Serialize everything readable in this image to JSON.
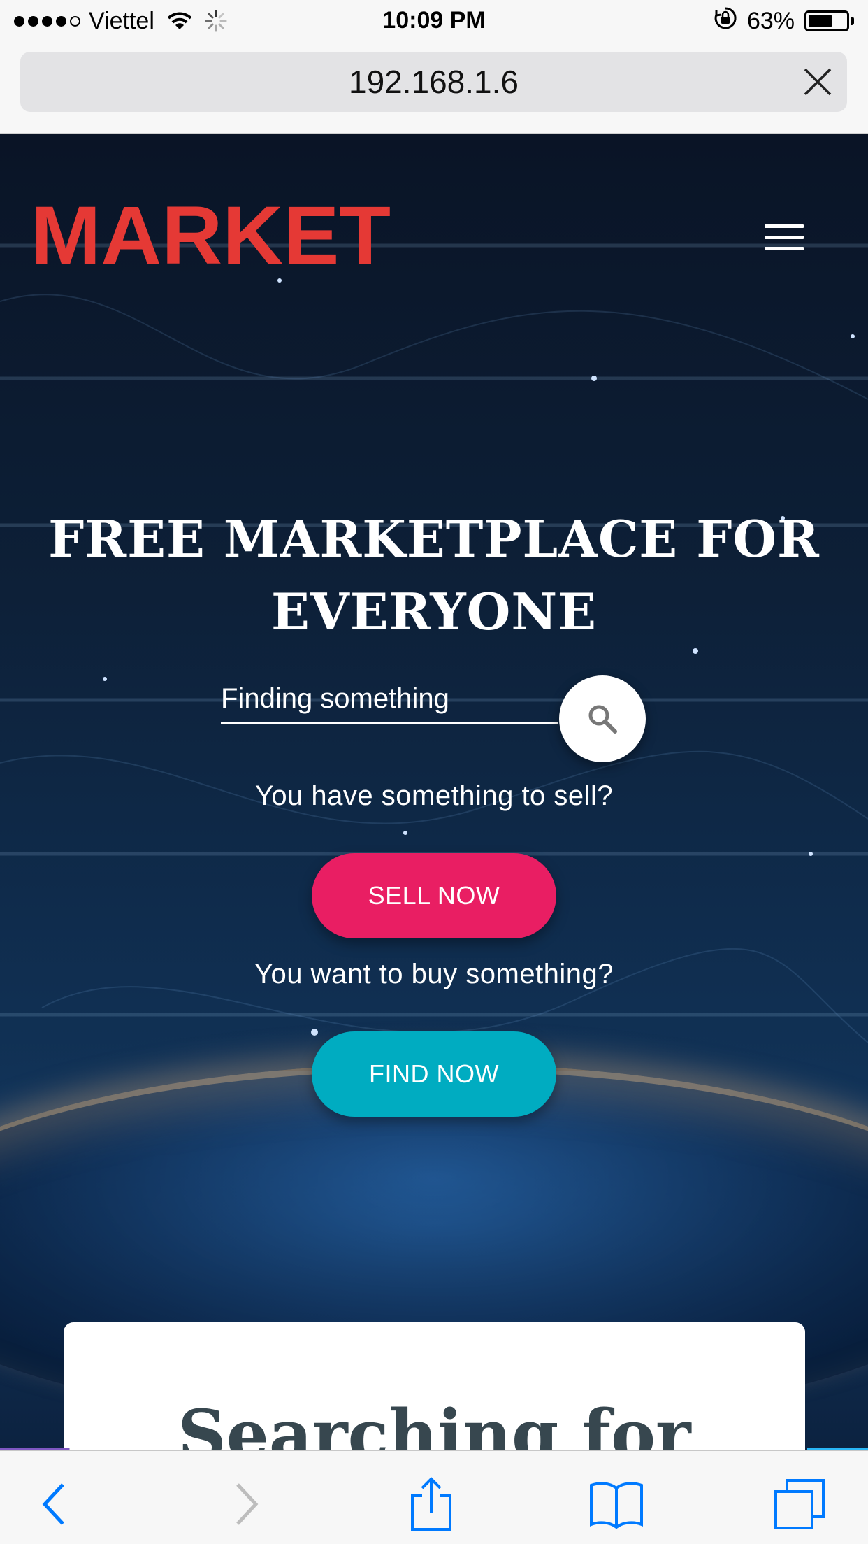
{
  "status_bar": {
    "carrier": "Viettel",
    "time": "10:09 PM",
    "battery_percent": "63%",
    "battery_level": 0.63,
    "icons": [
      "signal-dots-icon",
      "wifi-icon",
      "loading-spinner-icon",
      "rotation-lock-icon",
      "battery-icon"
    ]
  },
  "address_bar": {
    "url": "192.168.1.6",
    "close_icon": "close-icon"
  },
  "header": {
    "logo_text": "MARKET",
    "menu_icon": "hamburger-menu-icon"
  },
  "hero": {
    "headline": "FREE MARKETPLACE FOR EVERYONE",
    "search_placeholder": "Finding something",
    "search_icon": "search-icon",
    "sell_prompt": "You have something to sell?",
    "sell_button": "SELL NOW",
    "buy_prompt": "You want to buy something?",
    "find_button": "FIND NOW"
  },
  "card": {
    "title": "Searching for"
  },
  "toolbar": {
    "icons": [
      "back-icon",
      "forward-icon",
      "share-icon",
      "bookmarks-icon",
      "tabs-icon"
    ]
  },
  "colors": {
    "logo": "#e53935",
    "sell_button": "#e91e63",
    "find_button": "#00acc1",
    "ios_blue": "#007aff"
  }
}
